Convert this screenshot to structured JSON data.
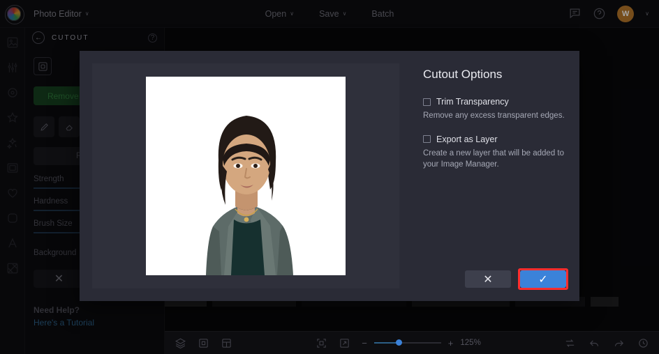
{
  "topbar": {
    "app_title": "Photo Editor",
    "app_chevron": "∨",
    "menu": [
      {
        "label": "Open",
        "chevron": "∨"
      },
      {
        "label": "Save",
        "chevron": "∨"
      },
      {
        "label": "Batch",
        "chevron": ""
      }
    ],
    "icons": {
      "feedback": "feedback-icon",
      "help": "?",
      "avatar_initial": "W",
      "avatar_chevron": "∨"
    },
    "accent_avatar": "#b5772a"
  },
  "rail": {
    "items": [
      {
        "name": "crop-icon"
      },
      {
        "name": "adjust-icon"
      },
      {
        "name": "focus-icon"
      },
      {
        "name": "effects-icon"
      },
      {
        "name": "magic-icon"
      },
      {
        "name": "frame-icon"
      },
      {
        "name": "retouch-icon"
      },
      {
        "name": "shapes-icon"
      },
      {
        "name": "text-icon"
      },
      {
        "name": "cutout-icon"
      }
    ]
  },
  "panel": {
    "title": "CUTOUT",
    "back_glyph": "←",
    "help_glyph": "?",
    "tool_icon": "selection-icon",
    "remove_button": "Remove Background",
    "brush_icon": "brush-icon",
    "reset_button": "Reset",
    "sliders": [
      {
        "label": "Strength"
      },
      {
        "label": "Hardness"
      },
      {
        "label": "Brush Size"
      }
    ],
    "background_label": "Background",
    "cancel_glyph": "✕",
    "confirm_glyph": "✓",
    "help_title": "Need Help?",
    "help_link": "Here's a Tutorial",
    "help_link_color": "#2c5f86",
    "green_button_color": "#16401f"
  },
  "modal": {
    "title": "Cutout Options",
    "options": [
      {
        "label": "Trim Transparency",
        "description": "Remove any excess transparent edges.",
        "checked": false
      },
      {
        "label": "Export as Layer",
        "description": "Create a new layer that will be added to your Image Manager.",
        "checked": false
      }
    ],
    "cancel_glyph": "✕",
    "confirm_glyph": "✓",
    "confirm_color": "#3b82d9",
    "highlight_color": "#ff2d2d",
    "preview_alt": "portrait-preview"
  },
  "bottombar": {
    "left_icons": [
      "layers-icon",
      "transform-icon",
      "compare-icon"
    ],
    "center_icons": [
      "fit-screen-icon",
      "actual-size-icon"
    ],
    "zoom_minus": "−",
    "zoom_plus": "+",
    "zoom_level": "125%",
    "right_icons": [
      "loop-icon",
      "undo-icon",
      "redo-icon",
      "history-icon"
    ]
  }
}
